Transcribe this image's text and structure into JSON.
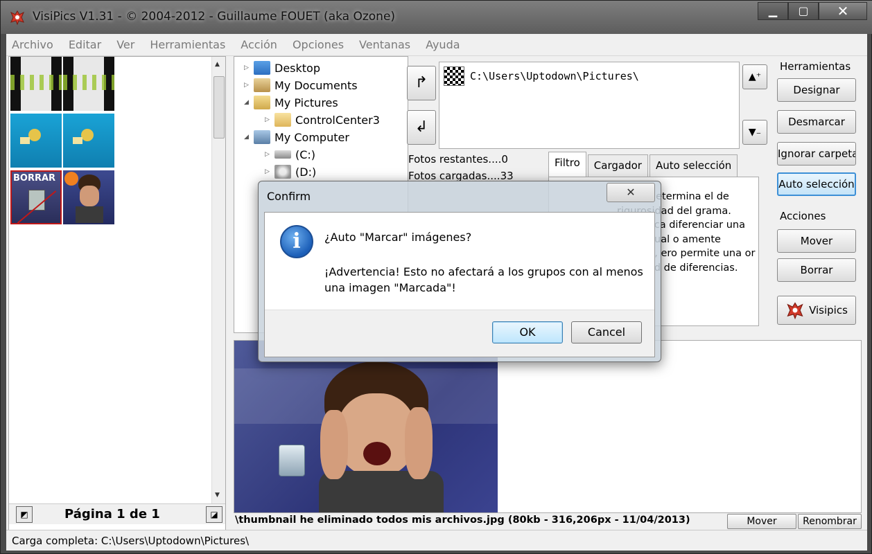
{
  "window": {
    "title": "VisiPics V1.31 - © 2004-2012 - Guillaume FOUET (aka Ozone)"
  },
  "menu": [
    "Archivo",
    "Editar",
    "Ver",
    "Herramientas",
    "Acción",
    "Opciones",
    "Ventanas",
    "Ayuda"
  ],
  "thumbnails": {
    "delete_label": "BORRAR"
  },
  "pager": {
    "label": "Página 1 de 1"
  },
  "tree": [
    {
      "label": "Desktop"
    },
    {
      "label": "My Documents"
    },
    {
      "label": "My Pictures"
    },
    {
      "label": "ControlCenter3"
    },
    {
      "label": "My Computer"
    },
    {
      "label": "(C:)"
    },
    {
      "label": "(D:)"
    }
  ],
  "folders": {
    "entry": "C:\\Users\\Uptodown\\Pictures\\"
  },
  "stats": {
    "remaining": "Fotos restantes....0",
    "loaded": "Fotos cargadas....33"
  },
  "tabs": [
    "Filtro",
    "Cargador",
    "Auto selección"
  ],
  "filter_text": "ontrol determina el de rigurosidad del grama. Exacto ca diferenciar una agen igual o amente distinta, ero permite una or cantidad de diferencias.",
  "tools": {
    "group1": "Herramientas",
    "designar": "Designar",
    "desmarcar": "Desmarcar",
    "ignorar": "Ignorar carpeta",
    "auto": "Auto selección",
    "group2": "Acciones",
    "mover": "Mover",
    "borrar": "Borrar",
    "visipics": "Visipics"
  },
  "preview": {
    "file_info": "\\thumbnail he eliminado todos mis archivos.jpg (80kb - 316,206px - 11/04/2013)",
    "mover": "Mover",
    "renombrar": "Renombrar"
  },
  "status": "Carga completa: C:\\Users\\Uptodown\\Pictures\\",
  "dialog": {
    "title": "Confirm",
    "question": "¿Auto \"Marcar\" imágenes?",
    "warning": "¡Advertencia! Esto no afectará a los grupos con al menos una imagen \"Marcada\"!",
    "ok": "OK",
    "cancel": "Cancel"
  },
  "colors": {
    "accent": "#3c8fd6",
    "delete_marker": "#f08020"
  }
}
